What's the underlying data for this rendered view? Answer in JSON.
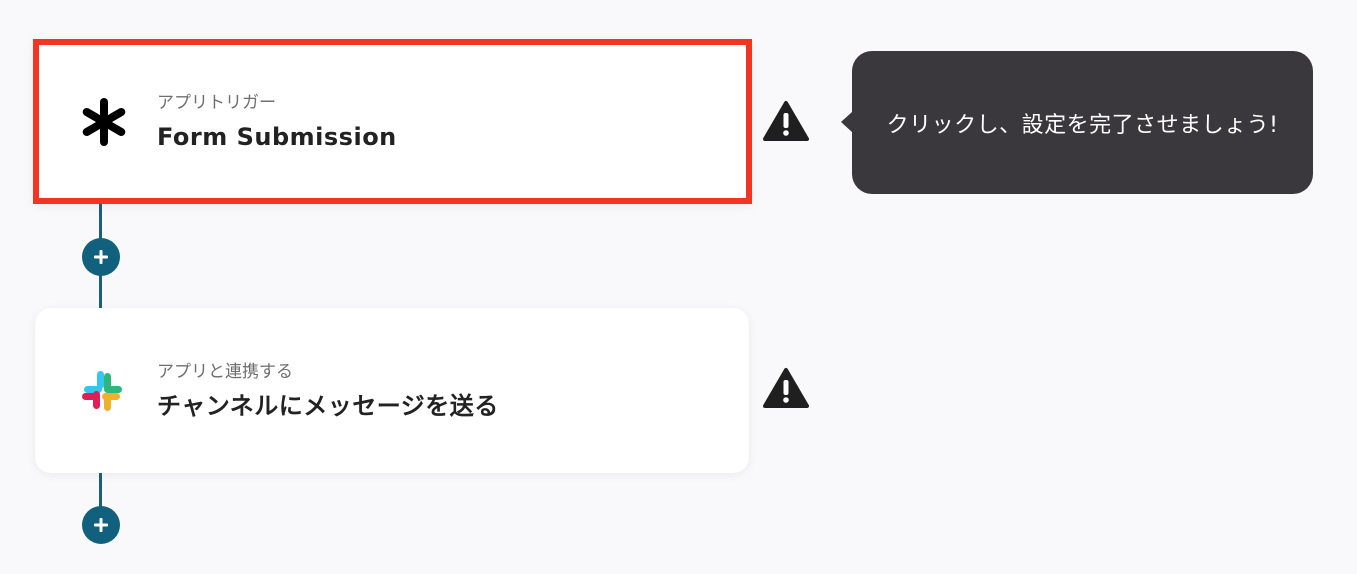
{
  "flow": {
    "steps": [
      {
        "type_label": "アプリトリガー",
        "title": "Form Submission",
        "icon": "asterisk-icon",
        "highlighted": true,
        "warning": true
      },
      {
        "type_label": "アプリと連携する",
        "title": "チャンネルにメッセージを送る",
        "icon": "slack-icon",
        "highlighted": false,
        "warning": true
      }
    ]
  },
  "tooltip": {
    "text": "クリックし、設定を完了させましょう!"
  },
  "colors": {
    "highlight_border": "#f23423",
    "connector": "#1d5f7a",
    "add_button": "#11607d",
    "tooltip_bg": "#3a383c",
    "background": "#f9f8fb",
    "slack": [
      "#36c5f0",
      "#2eb67d",
      "#ecb22e",
      "#e01e5a"
    ]
  }
}
